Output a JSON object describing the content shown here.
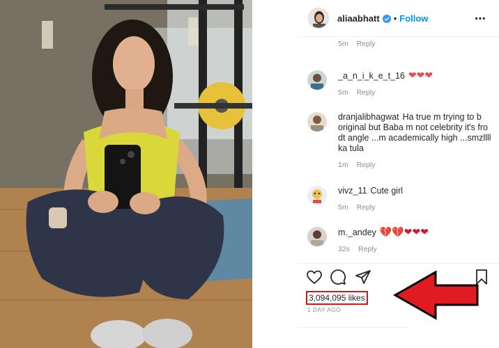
{
  "post": {
    "username": "aliaabhatt",
    "separator": "•",
    "follow_label": "Follow",
    "more_label": "⋯"
  },
  "comments": [
    {
      "username": "",
      "text": "",
      "time": "5m",
      "reply_label": "Reply"
    },
    {
      "username": "_a_n_i_k_e_t_16",
      "text": "❤❤❤",
      "time": "5m",
      "reply_label": "Reply"
    },
    {
      "username": "dranjalibhagwat",
      "text": "Ha true m trying to b original but Baba m not celebrity it's fro dt angle ...m academically high ...smzllll ka tula",
      "time": "1m",
      "reply_label": "Reply"
    },
    {
      "username": "vivz_11",
      "text": "Cute girl",
      "time": "5m",
      "reply_label": "Reply"
    },
    {
      "username": "m._andey",
      "text": "💔💔❤❤❤",
      "time": "32s",
      "reply_label": "Reply"
    }
  ],
  "engagement": {
    "likes_text": "3,094,095 likes",
    "posted_ago": "1 DAY AGO"
  },
  "colors": {
    "accent": "#0095f6",
    "highlight": "#d8141a",
    "heart": "#ed4956"
  },
  "icons": [
    "verified-badge-icon",
    "more-options-icon",
    "like-heart-icon",
    "comment-icon",
    "share-icon",
    "save-bookmark-icon",
    "annotation-arrow-icon"
  ]
}
